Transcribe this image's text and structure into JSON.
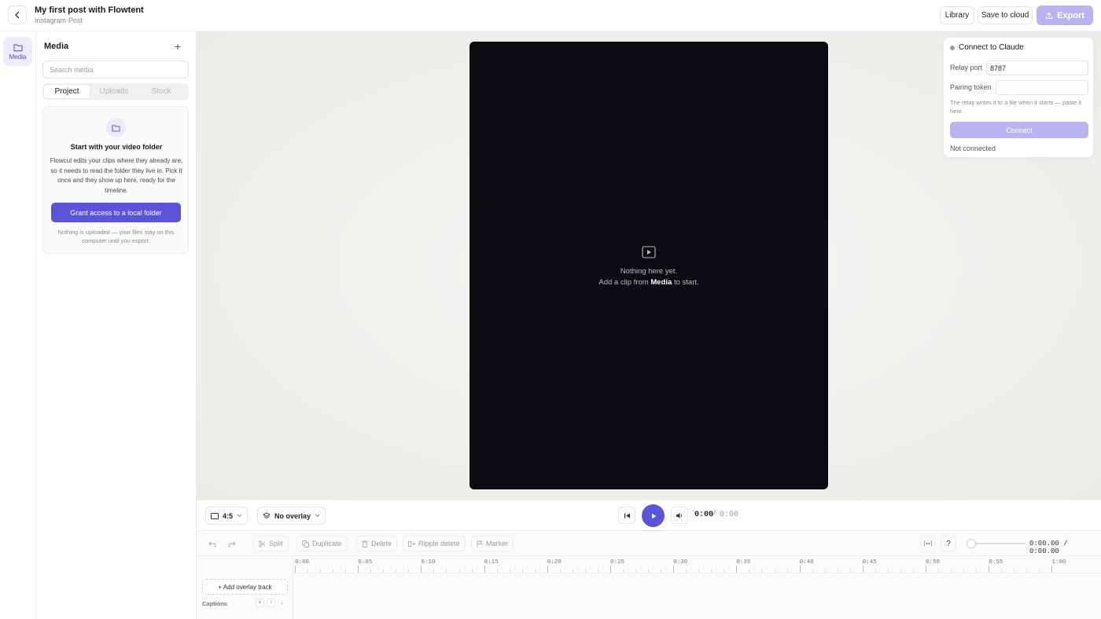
{
  "header": {
    "title": "My first post with Flowtent",
    "subtitle": "Instagram·Post",
    "library_label": "Library",
    "save_label": "Save to cloud",
    "export_label": "Export"
  },
  "rail": {
    "media_label": "Media"
  },
  "media_panel": {
    "title": "Media",
    "search_placeholder": "Search media",
    "tabs": [
      "Project",
      "Uploads",
      "Stock"
    ],
    "active_tab": "Project",
    "empty_title": "Start with your video folder",
    "empty_text": "Flowcut edits your clips where they already are, so it needs to read the folder they live in. Pick it once and they show up here, ready for the timeline.",
    "grant_button": "Grant access to a local folder",
    "note": "Nothing is uploaded — your files stay on this computer until you export."
  },
  "preview": {
    "empty_line1": "Nothing here yet.",
    "empty_line2_prefix": "Add a clip from",
    "empty_line2_bold": "Media",
    "empty_line2_suffix": "to start."
  },
  "connect_panel": {
    "title": "Connect to Claude",
    "relay_port_label": "Relay port",
    "relay_port_value": "8787",
    "pairing_token_label": "Pairing token",
    "pairing_token_value": "",
    "help_text": "The relay writes it to a file when it starts — paste it here.",
    "connect_button": "Connect",
    "status": "Not connected"
  },
  "player": {
    "aspect": "4:5",
    "overlay": "No overlay",
    "current_time": "0:00",
    "separator": "/",
    "total_time": "0:00"
  },
  "timeline_toolbar": {
    "split": "Split",
    "duplicate": "Duplicate",
    "delete": "Delete",
    "ripple_delete": "Ripple delete",
    "marker": "Marker",
    "help": "?",
    "time_readout": "0:00.00 / 0:00.00",
    "zoom_level": 0
  },
  "timeline": {
    "ticks": [
      "0:00",
      "0:05",
      "0:10",
      "0:15",
      "0:20",
      "0:25",
      "0:30",
      "0:35",
      "0:40",
      "0:45",
      "0:50",
      "0:55",
      "1:00"
    ],
    "add_overlay_track": "+ Add overlay track",
    "captions_label": "Captions"
  },
  "colors": {
    "accent": "#5b54d9",
    "accent_disabled": "#b9b3f2",
    "preview_bg": "#0c0b10"
  }
}
